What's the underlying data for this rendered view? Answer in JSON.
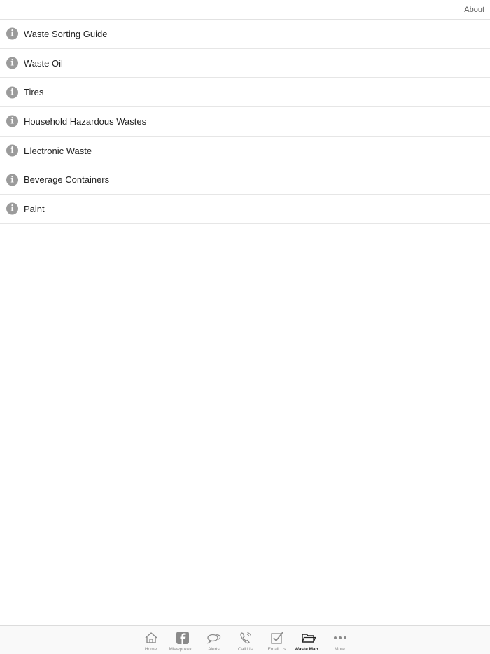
{
  "header": {
    "about_label": "About"
  },
  "list": {
    "items": [
      {
        "label": "Waste Sorting Guide",
        "icon": "info-icon"
      },
      {
        "label": "Waste Oil",
        "icon": "info-icon"
      },
      {
        "label": "Tires",
        "icon": "info-icon"
      },
      {
        "label": "Household Hazardous Wastes",
        "icon": "info-icon"
      },
      {
        "label": "Electronic Waste",
        "icon": "info-icon"
      },
      {
        "label": "Beverage Containers",
        "icon": "info-icon"
      },
      {
        "label": "Paint",
        "icon": "info-icon"
      }
    ],
    "info_glyph": "i"
  },
  "tabbar": {
    "active_tab": "Waste Man...",
    "tabs": [
      {
        "label": "Home",
        "icon": "home-icon"
      },
      {
        "label": "Miawpukek...",
        "icon": "facebook-icon"
      },
      {
        "label": "Alerts",
        "icon": "chat-bubbles-icon"
      },
      {
        "label": "Call Us",
        "icon": "phone-icon"
      },
      {
        "label": "Email Us",
        "icon": "checkbox-icon"
      },
      {
        "label": "Waste Man...",
        "icon": "folder-icon"
      },
      {
        "label": "More",
        "icon": "more-dots-icon"
      }
    ]
  },
  "colors": {
    "icon_gray": "#9b9b9b",
    "text": "#222222",
    "divider": "#e6e6e6",
    "tab_inactive": "#8a8a8a",
    "tab_active": "#222222"
  }
}
